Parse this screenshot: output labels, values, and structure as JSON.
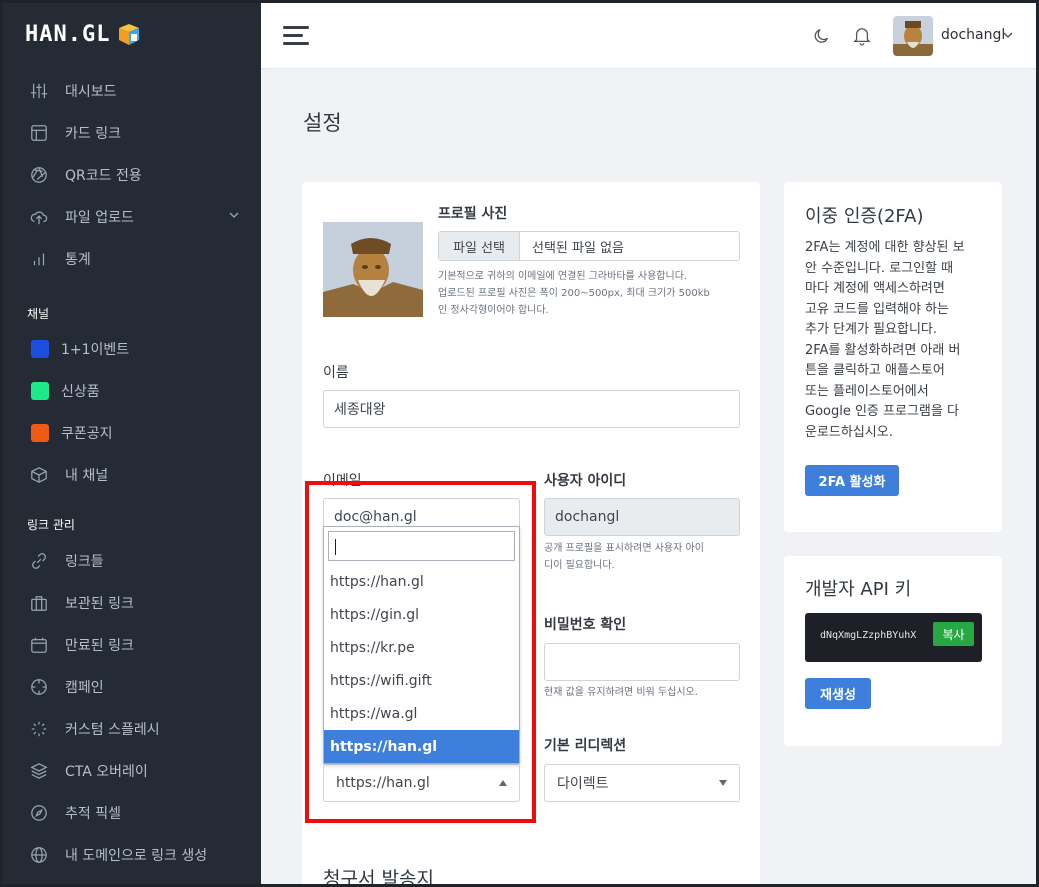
{
  "brand": {
    "logo_text": "HAN.GL"
  },
  "sidebar": {
    "items": [
      {
        "label": "대시보드",
        "icon": "sliders-icon"
      },
      {
        "label": "카드 링크",
        "icon": "layout-icon"
      },
      {
        "label": "QR코드 전용",
        "icon": "aperture-icon"
      },
      {
        "label": "파일 업로드",
        "icon": "upload-cloud-icon",
        "has_submenu": true
      },
      {
        "label": "통계",
        "icon": "bar-chart-icon"
      }
    ],
    "channels_heading": "채널",
    "channels": [
      {
        "label": "1+1이벤트",
        "color": "#1b4fe0"
      },
      {
        "label": "신상품",
        "color": "#1de98b"
      },
      {
        "label": "쿠폰공지",
        "color": "#f05a14"
      },
      {
        "label": "내 채널",
        "icon": "box-icon"
      }
    ],
    "links_heading": "링크 관리",
    "link_items": [
      {
        "label": "링크들",
        "icon": "link-icon"
      },
      {
        "label": "보관된 링크",
        "icon": "briefcase-icon"
      },
      {
        "label": "만료된 링크",
        "icon": "calendar-icon"
      },
      {
        "label": "캠페인",
        "icon": "crosshair-icon"
      },
      {
        "label": "커스텀 스플레시",
        "icon": "loader-icon"
      },
      {
        "label": "CTA 오버레이",
        "icon": "layers-icon"
      },
      {
        "label": "추적 픽셀",
        "icon": "compass-icon"
      },
      {
        "label": "내 도메인으로 링크 생성",
        "icon": "globe-icon"
      }
    ]
  },
  "header": {
    "username": "dochangl"
  },
  "page": {
    "title": "설정"
  },
  "profile": {
    "photo_label": "프로필 사진",
    "file_button": "파일 선택",
    "file_status": "선택된 파일 없음",
    "help_lines": [
      "기본적으로 귀하의 이메일에 연결된 그라바타를 사용합니다.",
      "업로드된 프로필 사진은 폭이 200~500px, 최대 크기가 500kb",
      "인 정사각형이어야 합니다."
    ]
  },
  "form": {
    "name_label": "이름",
    "name_value": "세종대왕",
    "email_label": "이메일",
    "email_value": "doc@han.gl",
    "userid_label": "사용자 아이디",
    "userid_value": "dochangl",
    "userid_help": [
      "공개 프로필을 표시하려면 사용자 아이",
      "디이 필요합니다."
    ],
    "confirm_pw_label": "비밀번호 확인",
    "confirm_pw_help": "현재 값을 유지하려면 비워 두십시오.",
    "redirect_label": "기본 리디렉션",
    "redirect_value": "다이렉트",
    "domain_value": "https://han.gl",
    "domain_options": [
      "https://han.gl",
      "https://gin.gl",
      "https://kr.pe",
      "https://wifi.gift",
      "https://wa.gl",
      "https://han.gl"
    ],
    "domain_selected_index": 5,
    "billing_heading": "청구서 발송지"
  },
  "tfa": {
    "title": "이중 인증(2FA)",
    "lines": [
      "2FA는 계정에 대한 향상된 보",
      "안 수준입니다. 로그인할 때",
      "마다 계정에 액세스하려면",
      "고유 코드를 입력해야 하는",
      "추가 단계가 필요합니다.",
      "2FA를 활성화하려면 아래 버",
      "튼을 클릭하고 애플스토어",
      "또는 플레이스토어에서",
      "Google 인증 프로그램을 다",
      "운로드하십시오."
    ],
    "button": "2FA 활성화"
  },
  "api": {
    "title": "개발자 API 키",
    "key": "dNqXmgLZzphBYuhX",
    "copy_label": "복사",
    "regen_label": "재생성"
  },
  "colors": {
    "accent": "#3d7fdb",
    "sidebar_bg": "#242b35",
    "highlight_box": "#ee0c0c",
    "copy_green": "#28a745"
  }
}
